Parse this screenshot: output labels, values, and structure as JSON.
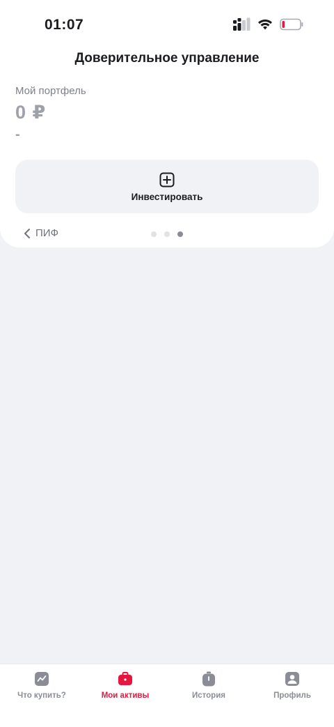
{
  "status_bar": {
    "time": "01:07",
    "icons": [
      "cellular-signal-icon",
      "wifi-icon",
      "battery-low-icon"
    ]
  },
  "header": {
    "title": "Доверительное управление"
  },
  "portfolio": {
    "label": "Мой портфель",
    "value": "0 ₽",
    "change": "-"
  },
  "invest_card": {
    "icon": "plus-square-icon",
    "label": "Инвестировать"
  },
  "pager": {
    "back_label": "ПИФ",
    "pages_total": 3,
    "current_page": 3
  },
  "tabbar": {
    "items": [
      {
        "label": "Что купить?",
        "icon": "chart-trend-icon",
        "active": false
      },
      {
        "label": "Мои активы",
        "icon": "briefcase-icon",
        "active": true
      },
      {
        "label": "История",
        "icon": "timer-icon",
        "active": false
      },
      {
        "label": "Профиль",
        "icon": "profile-icon",
        "active": false
      }
    ]
  },
  "colors": {
    "accent": "#e5173f",
    "background": "#f1f2f5",
    "text_primary": "#1b1c1f",
    "text_muted": "#9ea1a9"
  }
}
